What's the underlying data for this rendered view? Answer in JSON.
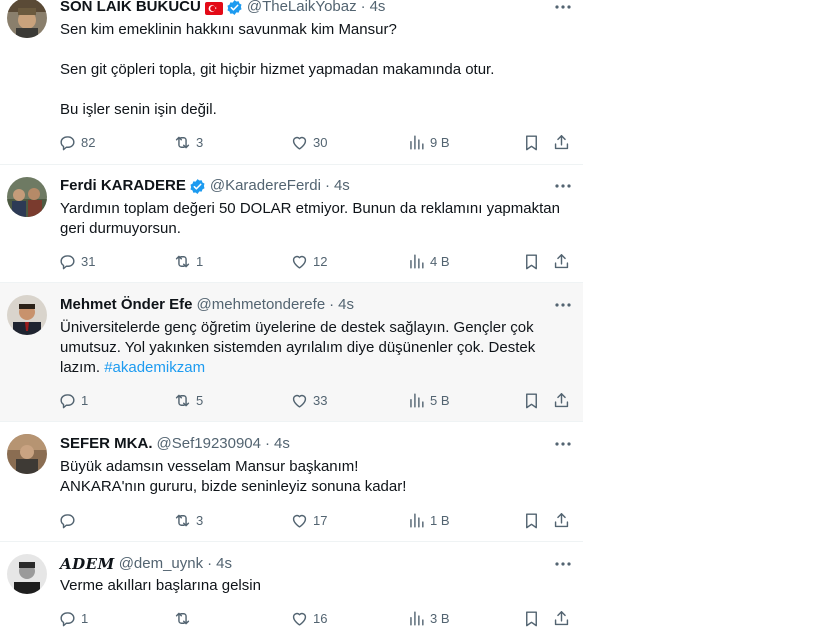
{
  "colors": {
    "text": "#0f1419",
    "secondary": "#536471",
    "accent": "#1d9bf0",
    "hover_row": "#f7f7f7",
    "divider": "#eff3f4"
  },
  "tweets": [
    {
      "name": "SON LAİK BÜKÜCÜ",
      "flag": "turkey-flag",
      "verified": true,
      "handle": "@TheLaikYobaz",
      "separator": "·",
      "time": "4s",
      "lines": [
        "Sen kim emeklinin hakkını savunmak kim Mansur?",
        "",
        "Sen git çöpleri topla, git hiçbir hizmet yapmadan makamında otur.",
        "",
        "Bu işler senin işin değil."
      ],
      "replies": "82",
      "reposts": "3",
      "likes": "30",
      "views": "9 B"
    },
    {
      "name": "Ferdi KARADERE",
      "verified": true,
      "handle": "@KaradereFerdi",
      "separator": "·",
      "time": "4s",
      "lines": [
        "Yardımın toplam değeri 50 DOLAR etmiyor. Bunun da reklamını yapmaktan",
        "geri durmuyorsun."
      ],
      "replies": "31",
      "reposts": "1",
      "likes": "12",
      "views": "4 B"
    },
    {
      "name": "Mehmet Önder Efe",
      "verified": false,
      "handle": "@mehmetonderefe",
      "separator": "·",
      "time": "4s",
      "lines": [
        "Üniversitelerde genç öğretim üyelerine de destek sağlayın. Gençler çok",
        "umutsuz. Yol yakınken sistemden ayrılalım diye düşünenler çok. Destek",
        "lazım. "
      ],
      "hashtag": "#akademikzam",
      "replies": "1",
      "reposts": "5",
      "likes": "33",
      "views": "5 B"
    },
    {
      "name": "SEFER MKA.",
      "verified": false,
      "handle": "@Sef19230904",
      "separator": "·",
      "time": "4s",
      "lines": [
        "Büyük adamsın vesselam Mansur başkanım!",
        "ANKARA'nın gururu, bizde seninleyiz sonuna kadar!"
      ],
      "replies": "",
      "reposts": "3",
      "likes": "17",
      "views": "1 B"
    },
    {
      "name": "𝑨𝑫𝑬𝑴",
      "verified": false,
      "handle": "@dem_uynk",
      "separator": "·",
      "time": "4s",
      "lines": [
        "Verme akılları başlarına gelsin"
      ],
      "replies": "1",
      "reposts": "",
      "likes": "16",
      "views": "3 B"
    }
  ]
}
